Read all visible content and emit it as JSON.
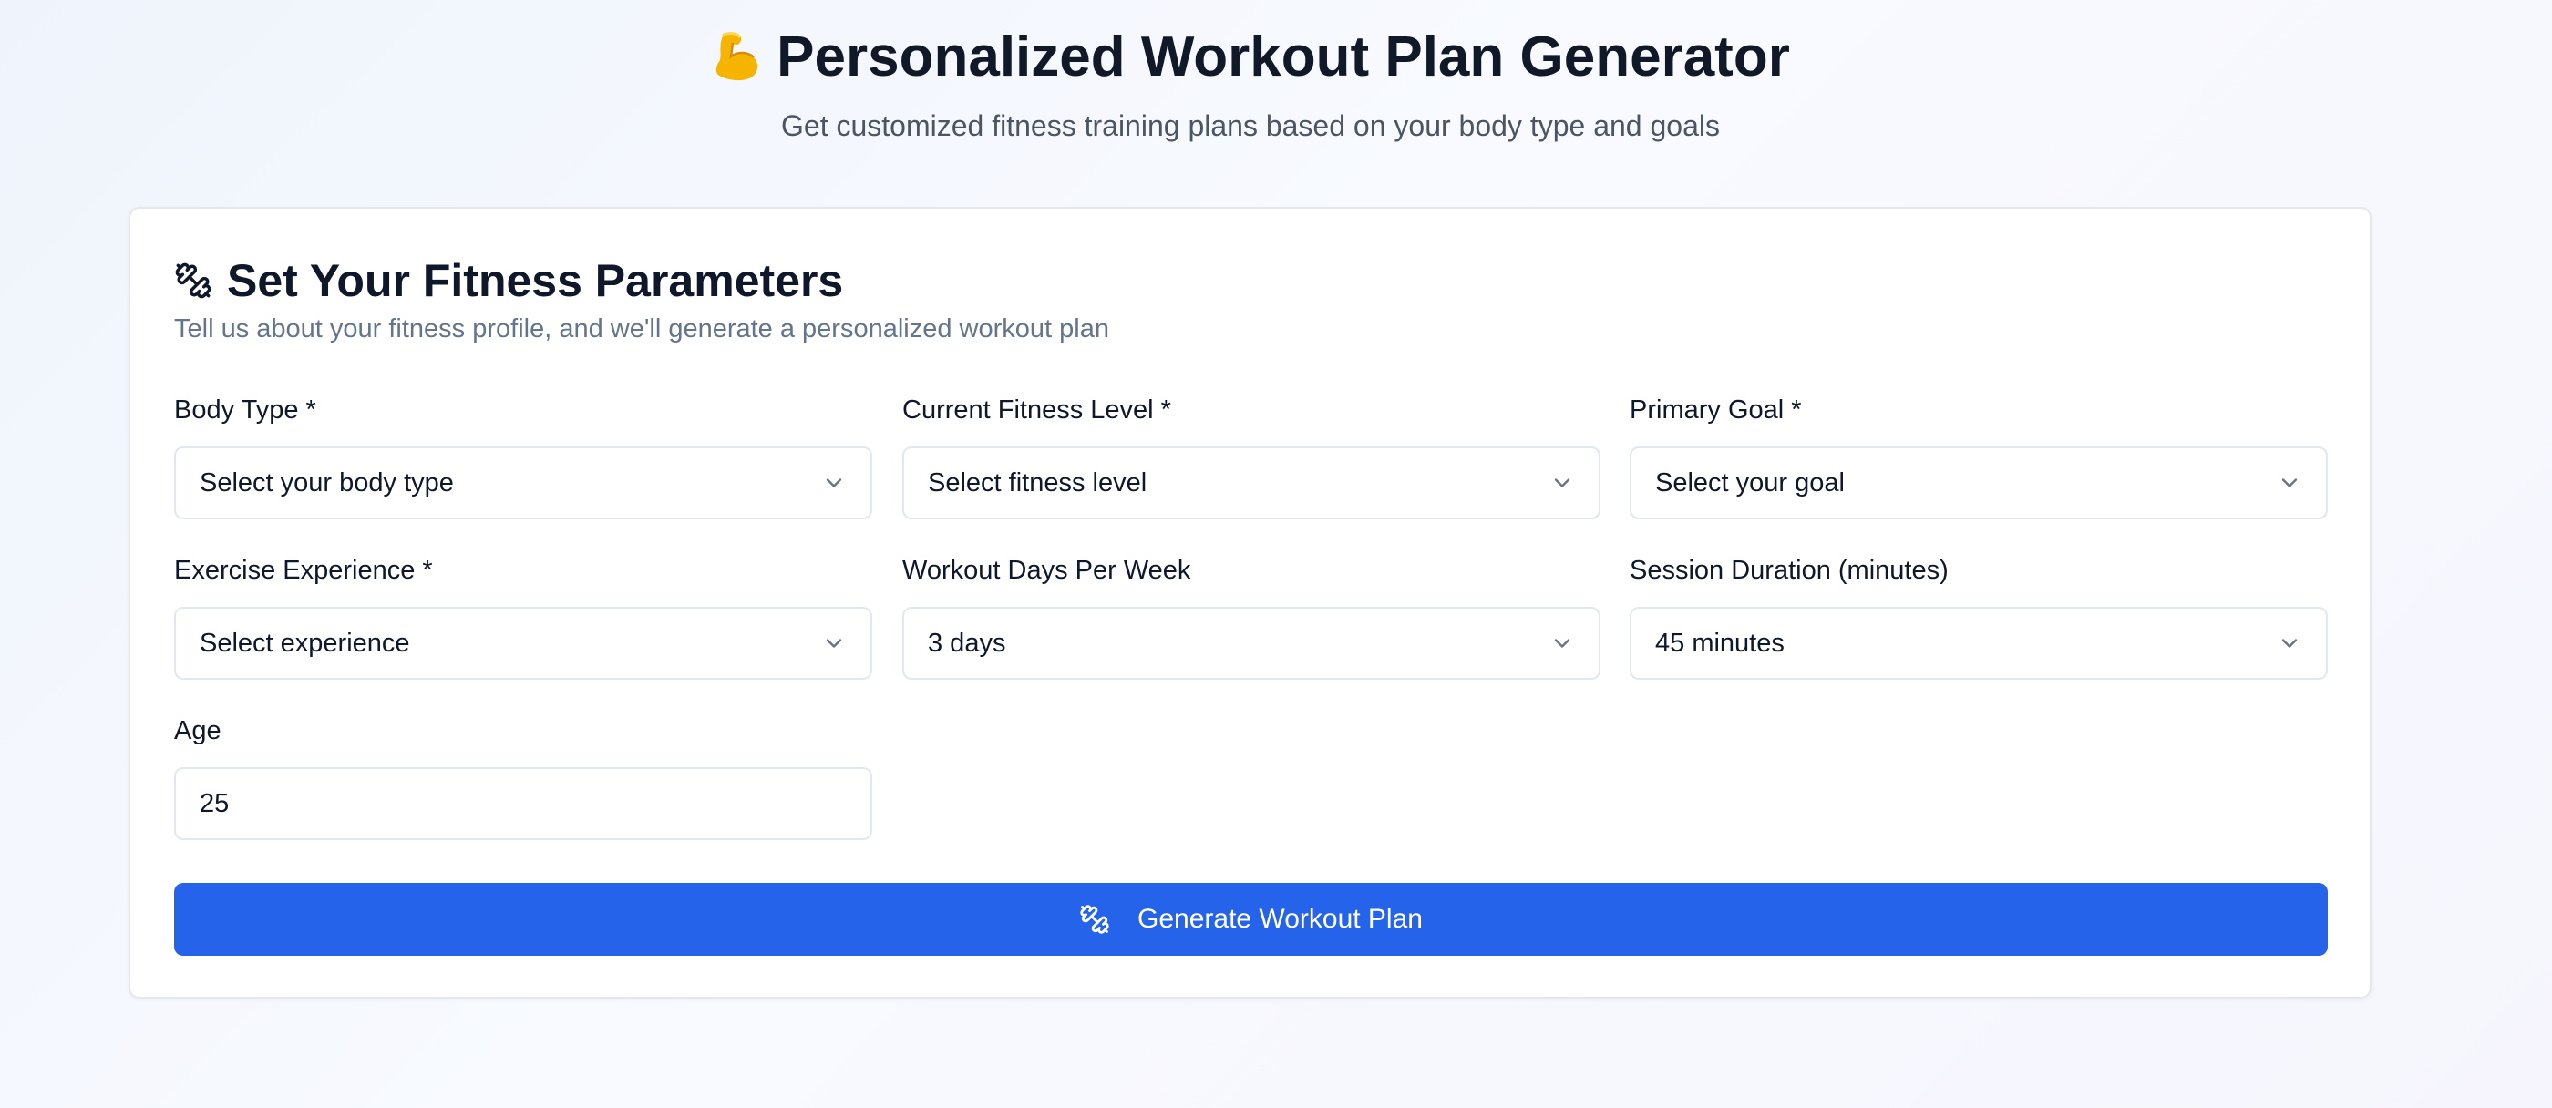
{
  "header": {
    "title": "Personalized Workout Plan Generator",
    "title_icon": "flexed-biceps-emoji",
    "subtitle": "Get customized fitness training plans based on your body type and goals"
  },
  "card": {
    "title": "Set Your Fitness Parameters",
    "title_icon": "dumbbell-icon",
    "description": "Tell us about your fitness profile, and we'll generate a personalized workout plan"
  },
  "fields": {
    "body_type": {
      "label": "Body Type *",
      "value": "Select your body type"
    },
    "fitness_level": {
      "label": "Current Fitness Level *",
      "value": "Select fitness level"
    },
    "primary_goal": {
      "label": "Primary Goal *",
      "value": "Select your goal"
    },
    "experience": {
      "label": "Exercise Experience *",
      "value": "Select experience"
    },
    "days_per_week": {
      "label": "Workout Days Per Week",
      "value": "3 days"
    },
    "session_duration": {
      "label": "Session Duration (minutes)",
      "value": "45 minutes"
    },
    "age": {
      "label": "Age",
      "value": "25"
    }
  },
  "actions": {
    "generate_label": "Generate Workout Plan",
    "generate_icon": "dumbbell-icon"
  },
  "colors": {
    "primary": "#2563eb",
    "heading": "#111827",
    "muted": "#64748b",
    "border": "#e2e8f0"
  }
}
